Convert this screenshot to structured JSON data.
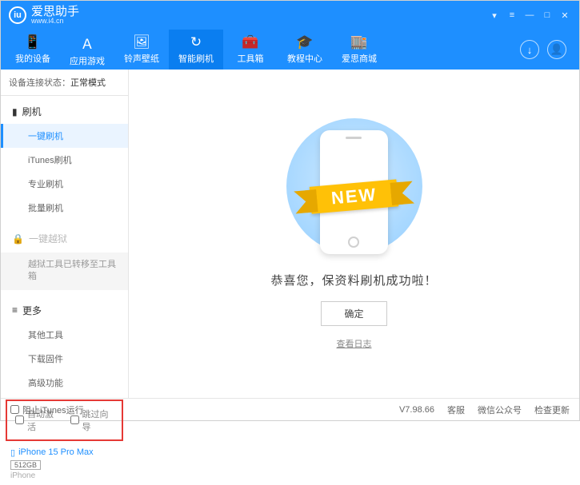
{
  "brand": {
    "name": "爱思助手",
    "sub": "www.i4.cn",
    "logo": "iu"
  },
  "nav": {
    "items": [
      {
        "label": "我的设备",
        "icon": "📱"
      },
      {
        "label": "应用游戏",
        "icon": "Ａ"
      },
      {
        "label": "铃声壁纸",
        "icon": "🖼"
      },
      {
        "label": "智能刷机",
        "icon": "↻"
      },
      {
        "label": "工具箱",
        "icon": "🧰"
      },
      {
        "label": "教程中心",
        "icon": "🎓"
      },
      {
        "label": "爱思商城",
        "icon": "🏬"
      }
    ]
  },
  "status": {
    "label": "设备连接状态：",
    "value": "正常模式"
  },
  "sidebar": {
    "flash": {
      "head": "刷机",
      "items": [
        "一键刷机",
        "iTunes刷机",
        "专业刷机",
        "批量刷机"
      ]
    },
    "jailbreak": {
      "head": "一键越狱",
      "note": "越狱工具已转移至工具箱"
    },
    "more": {
      "head": "更多",
      "items": [
        "其他工具",
        "下载固件",
        "高级功能"
      ]
    },
    "options": {
      "auto_activate": "自动激活",
      "skip_wizard": "跳过向导"
    }
  },
  "device": {
    "name": "iPhone 15 Pro Max",
    "storage": "512GB",
    "type": "iPhone"
  },
  "main": {
    "ribbon": "NEW",
    "message": "恭喜您，保资料刷机成功啦！",
    "ok": "确定",
    "log": "查看日志"
  },
  "footer": {
    "block_itunes": "阻止iTunes运行",
    "version": "V7.98.66",
    "links": [
      "客服",
      "微信公众号",
      "检查更新"
    ]
  }
}
